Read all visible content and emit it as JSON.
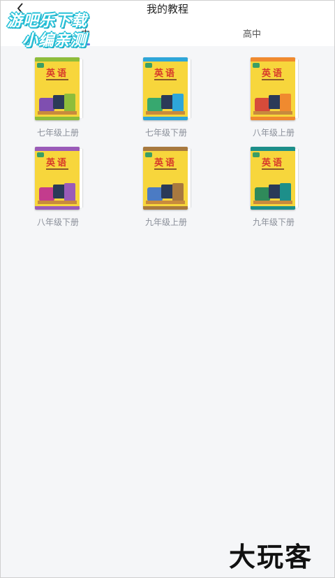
{
  "header": {
    "title": "我的教程",
    "back_icon": "chevron-left-icon"
  },
  "tabs": [
    {
      "label": "中",
      "active": true
    },
    {
      "label": "高中",
      "active": false
    }
  ],
  "watermark": {
    "line1": "游吧乐下载",
    "line2": "小编亲测"
  },
  "books": [
    {
      "label": "七年级上册",
      "cover_title": "英语",
      "accent": "#8ebd3b",
      "art": "#7f4fb0"
    },
    {
      "label": "七年级下册",
      "cover_title": "英语",
      "accent": "#2ea6d9",
      "art": "#37a86f"
    },
    {
      "label": "八年级上册",
      "cover_title": "英语",
      "accent": "#f08a2f",
      "art": "#d64b3a"
    },
    {
      "label": "八年级下册",
      "cover_title": "英语",
      "accent": "#9a5bb8",
      "art": "#c33c8d"
    },
    {
      "label": "九年级上册",
      "cover_title": "英语",
      "accent": "#a8793f",
      "art": "#4b7bc4"
    },
    {
      "label": "九年级下册",
      "cover_title": "英语",
      "accent": "#1d8f8a",
      "art": "#2f8a5a"
    }
  ],
  "footer_logo": {
    "text": "大玩客"
  },
  "colors": {
    "background": "#f5f6f8",
    "tab_indicator": "#6a7de4",
    "label": "#8a8f99"
  }
}
